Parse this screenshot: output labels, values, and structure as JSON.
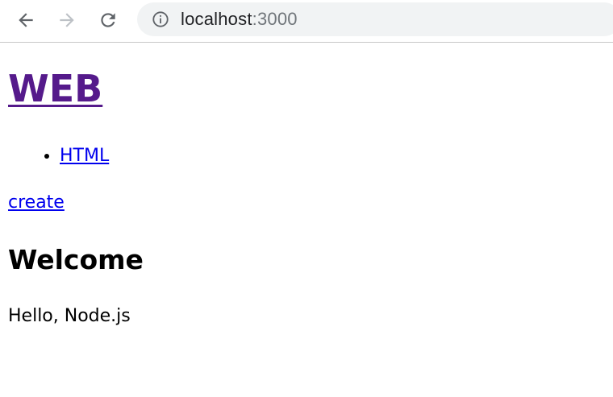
{
  "browser": {
    "url_host": "localhost",
    "url_port": ":3000",
    "icons": {
      "back": "arrow-left-icon",
      "forward": "arrow-right-icon",
      "reload": "reload-icon",
      "info": "info-icon"
    }
  },
  "page": {
    "site_title": "WEB",
    "topics": [
      {
        "label": "HTML"
      }
    ],
    "create_label": "create",
    "heading": "Welcome",
    "description": "Hello, Node.js"
  },
  "colors": {
    "visited_link": "#551a8b",
    "link": "#0000ee",
    "omnibox_bg": "#f1f3f4"
  }
}
